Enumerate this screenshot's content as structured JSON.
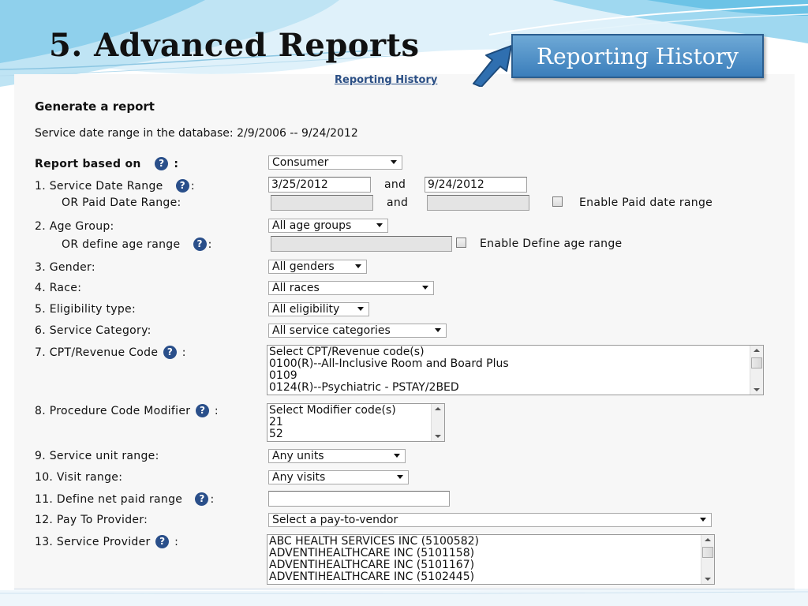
{
  "slide": {
    "title": "5. Advanced Reports",
    "badge": "Reporting History",
    "accent_color": "#3b7ebb"
  },
  "panel": {
    "link": "Reporting History",
    "heading": "Generate a report",
    "date_range_text": "Service date range in the database: 2/9/2006 -- 9/24/2012"
  },
  "help_glyph": "?",
  "form": {
    "report_based_on": {
      "label": "Report based on",
      "suffix": ":",
      "value": "Consumer"
    },
    "service_date": {
      "label": "1.  Service Date Range",
      "suffix": ":",
      "from": "3/25/2012",
      "and": "and",
      "to": "9/24/2012"
    },
    "paid_date": {
      "label": "OR Paid Date Range:",
      "and": "and",
      "checkbox_label": "Enable Paid date range"
    },
    "age_group": {
      "label": "2.  Age Group:",
      "value": "All age groups"
    },
    "age_range": {
      "label": "OR define age range",
      "suffix": ":",
      "checkbox_label": "Enable Define age range"
    },
    "gender": {
      "label": "3.  Gender:",
      "value": "All genders"
    },
    "race": {
      "label": "4.  Race:",
      "value": "All races"
    },
    "eligibility": {
      "label": "5.  Eligibility type:",
      "value": "All eligibility"
    },
    "service_category": {
      "label": "6.  Service Category:",
      "value": "All service categories"
    },
    "cpt": {
      "label": "7.  CPT/Revenue Code",
      "suffix": ":",
      "options": [
        "Select CPT/Revenue code(s)",
        "0100(R)--All-Inclusive Room and Board Plus",
        "0109",
        "0124(R)--Psychiatric - PSTAY/2BED"
      ]
    },
    "modifier": {
      "label": "8.  Procedure Code Modifier",
      "suffix": ":",
      "options": [
        "Select Modifier code(s)",
        "21",
        "52"
      ]
    },
    "service_unit": {
      "label": "9.  Service unit range:",
      "value": "Any units"
    },
    "visit": {
      "label": "10.  Visit range:",
      "value": "Any visits"
    },
    "net_paid": {
      "label": "11.  Define net paid range",
      "suffix": ":",
      "value": ""
    },
    "pay_to": {
      "label": "12.  Pay To Provider:",
      "value": "Select a pay-to-vendor"
    },
    "service_provider": {
      "label": "13.  Service Provider",
      "suffix": ":",
      "options": [
        "ABC HEALTH SERVICES INC (5100582)",
        "ADVENTIHEALTHCARE INC (5101158)",
        "ADVENTIHEALTHCARE INC (5101167)",
        "ADVENTIHEALTHCARE INC (5102445)"
      ]
    }
  }
}
